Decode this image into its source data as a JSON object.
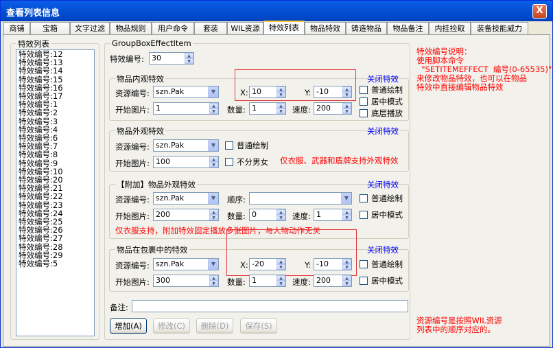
{
  "window": {
    "title": "查看列表信息",
    "close_label": "X"
  },
  "tabs": [
    "商铺",
    "宝箱",
    "文字过滤",
    "物品规则",
    "用户命令",
    "套装",
    "WIL资源",
    "特效列表",
    "物品特效",
    "铸造物品",
    "物品备注",
    "内挂捡取",
    "装备技能威力"
  ],
  "active_tab": "特效列表",
  "left_list": {
    "title": "特效列表",
    "items": [
      "特效编号:12",
      "特效编号:13",
      "特效编号:14",
      "特效编号:15",
      "特效编号:16",
      "特效编号:17",
      "特效编号:1",
      "特效编号:2",
      "特效编号:3",
      "特效编号:4",
      "特效编号:6",
      "特效编号:7",
      "特效编号:8",
      "特效编号:9",
      "特效编号:10",
      "特效编号:20",
      "特效编号:21",
      "特效编号:22",
      "特效编号:23",
      "特效编号:24",
      "特效编号:25",
      "特效编号:26",
      "特效编号:27",
      "特效编号:28",
      "特效编号:29",
      "特效编号:5"
    ]
  },
  "main": {
    "title": "GroupBoxEffectItem",
    "effect_id_label": "特效编号:",
    "effect_id_value": "30",
    "close_effect": "关闭特效",
    "inner": {
      "title": "物品内观特效",
      "res_label": "资源编号:",
      "res_value": "szn.Pak",
      "start_label": "开始图片:",
      "start_value": "1",
      "x_label": "X:",
      "x_value": "10",
      "y_label": "Y:",
      "y_value": "-10",
      "count_label": "数量:",
      "count_value": "1",
      "speed_label": "速度:",
      "speed_value": "200",
      "chk_normal": "普通绘制",
      "chk_center": "居中模式",
      "chk_bottom": "底层播放"
    },
    "outer": {
      "title": "物品外观特效",
      "res_label": "资源编号:",
      "res_value": "szn.Pak",
      "start_label": "开始图片:",
      "start_value": "100",
      "chk_normal": "普通绘制",
      "chk_gender": "不分男女",
      "note": "仅衣服、武器和盾牌支持外观特效"
    },
    "extra": {
      "title": "【附加】物品外观特效",
      "res_label": "资源编号:",
      "res_value": "szn.Pak",
      "order_label": "顺序:",
      "order_value": "",
      "start_label": "开始图片:",
      "start_value": "200",
      "count_label": "数量:",
      "count_value": "0",
      "speed_label": "速度:",
      "speed_value": "1",
      "chk_normal": "普通绘制",
      "chk_center": "居中模式",
      "note": "仅衣服支持，附加特效固定播放多张图片，与人物动作无关"
    },
    "bag": {
      "title": "物品在包裹中的特效",
      "res_label": "资源编号:",
      "res_value": "szn.Pak",
      "start_label": "开始图片:",
      "start_value": "300",
      "x_label": "X:",
      "x_value": "-20",
      "y_label": "Y:",
      "y_value": "-10",
      "count_label": "数量:",
      "count_value": "1",
      "speed_label": "速度:",
      "speed_value": "200",
      "chk_normal": "普通绘制",
      "chk_center": "居中模式"
    },
    "remark_label": "备注:",
    "remark_value": "",
    "buttons": {
      "add": "增加(A)",
      "modify": "修改(C)",
      "delete": "删除(D)",
      "save": "保存(S)"
    }
  },
  "help": {
    "lines": [
      "特效编号说明：",
      "使用脚本命令",
      "  \"SETITEMEFFECT  编号(0-65535)\"",
      "来修改物品特效，也可以在物品",
      "特效中直接编辑物品特效"
    ],
    "res_lines": [
      "资源编号是按照WIL资源",
      "列表中的顺序对应的。"
    ]
  }
}
